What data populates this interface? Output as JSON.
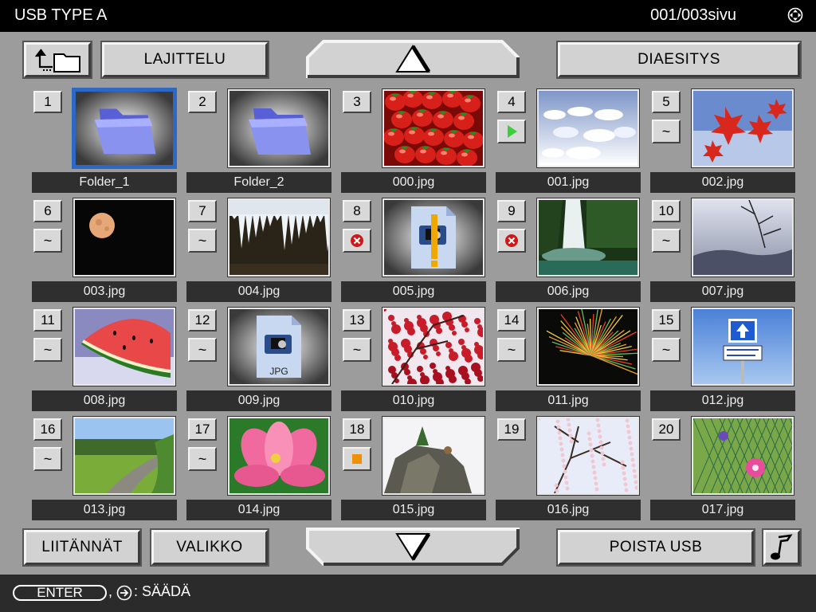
{
  "header": {
    "title": "USB TYPE A",
    "page_indicator": "001/003sivu",
    "nav_icon": "direction-pad-icon"
  },
  "toolbar": {
    "up_folder_icon": "folder-up-icon",
    "sort_label": "LAJITTELU",
    "slideshow_label": "DIAESITYS",
    "scroll_up_icon": "arrow-up-icon"
  },
  "footer_buttons": {
    "inputs_label": "LIITÄNNÄT",
    "menu_label": "VALIKKO",
    "remove_usb_label": "POISTA USB",
    "scroll_down_icon": "arrow-down-icon",
    "music_icon": "music-note-icon"
  },
  "status_bar": {
    "enter_key": "ENTER",
    "comma": ",",
    "hint": ": SÄÄDÄ"
  },
  "tiles": [
    {
      "num": "1",
      "caption": "Folder_1",
      "status": "",
      "thumb": "folder",
      "selected": true
    },
    {
      "num": "2",
      "caption": "Folder_2",
      "status": "",
      "thumb": "folder"
    },
    {
      "num": "3",
      "caption": "000.jpg",
      "status": "",
      "thumb": "strawberries"
    },
    {
      "num": "4",
      "caption": "001.jpg",
      "status": "play",
      "thumb": "snow"
    },
    {
      "num": "5",
      "caption": "002.jpg",
      "status": "~",
      "thumb": "maple"
    },
    {
      "num": "6",
      "caption": "003.jpg",
      "status": "~",
      "thumb": "moon"
    },
    {
      "num": "7",
      "caption": "004.jpg",
      "status": "~",
      "thumb": "icicles"
    },
    {
      "num": "8",
      "caption": "005.jpg",
      "status": "error",
      "thumb": "broken"
    },
    {
      "num": "9",
      "caption": "006.jpg",
      "status": "error",
      "thumb": "waterfall"
    },
    {
      "num": "10",
      "caption": "007.jpg",
      "status": "~",
      "thumb": "mist"
    },
    {
      "num": "11",
      "caption": "008.jpg",
      "status": "~",
      "thumb": "watermelon"
    },
    {
      "num": "12",
      "caption": "009.jpg",
      "status": "~",
      "thumb": "jpgfile",
      "file_label": "JPG"
    },
    {
      "num": "13",
      "caption": "010.jpg",
      "status": "~",
      "thumb": "redtree"
    },
    {
      "num": "14",
      "caption": "011.jpg",
      "status": "~",
      "thumb": "fireworks"
    },
    {
      "num": "15",
      "caption": "012.jpg",
      "status": "~",
      "thumb": "sign"
    },
    {
      "num": "16",
      "caption": "013.jpg",
      "status": "~",
      "thumb": "road"
    },
    {
      "num": "17",
      "caption": "014.jpg",
      "status": "~",
      "thumb": "lotus"
    },
    {
      "num": "18",
      "caption": "015.jpg",
      "status": "stop",
      "thumb": "rock"
    },
    {
      "num": "19",
      "caption": "016.jpg",
      "status": "",
      "thumb": "blossom"
    },
    {
      "num": "20",
      "caption": "017.jpg",
      "status": "",
      "thumb": "flower"
    }
  ],
  "colors": {
    "selected_border": "#2c68c4",
    "play": "#3ccf3c",
    "error": "#d01818",
    "stop": "#f0900a"
  }
}
